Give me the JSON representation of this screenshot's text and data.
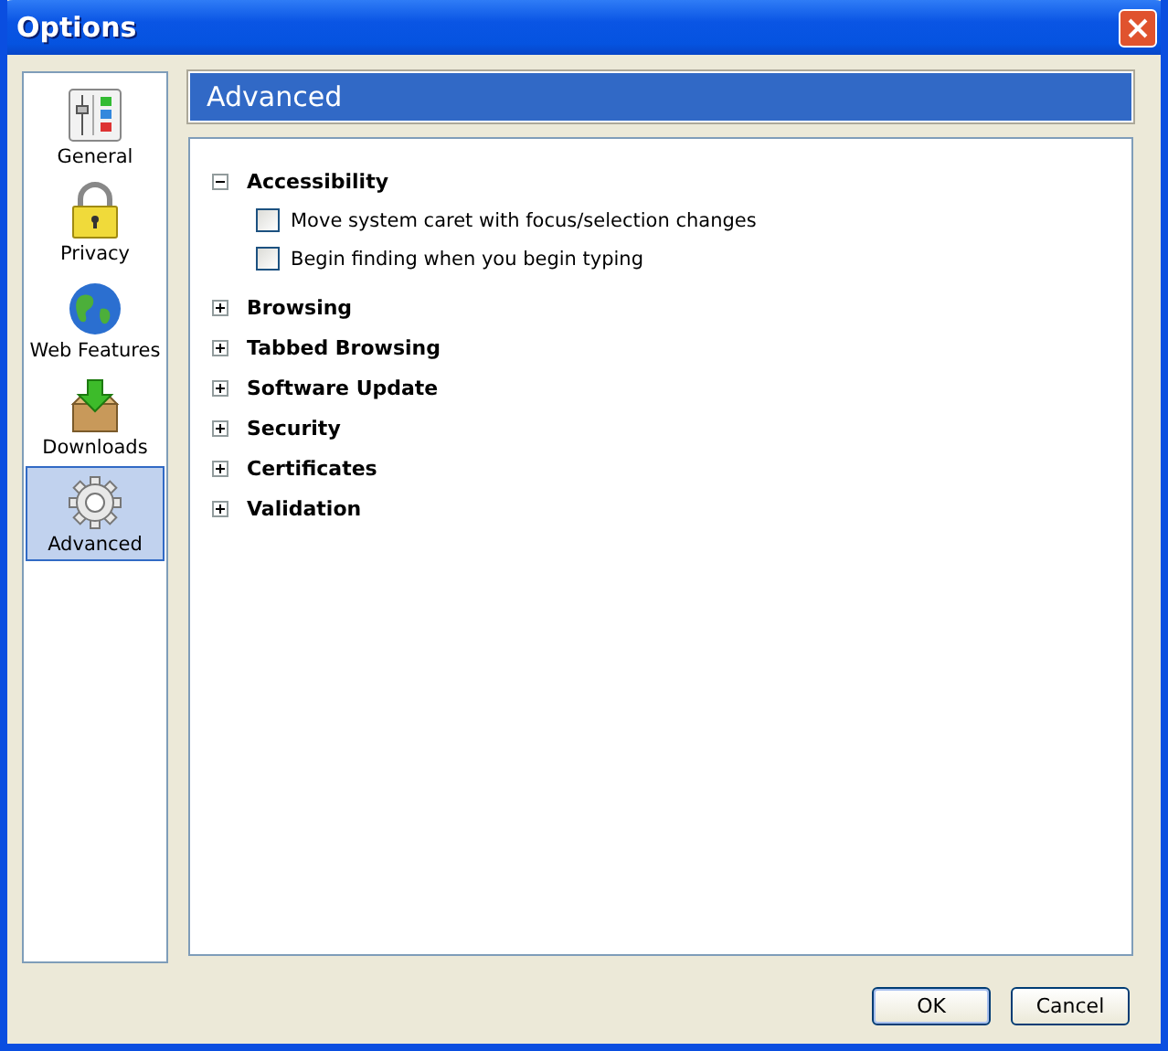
{
  "window": {
    "title": "Options"
  },
  "sidebar": {
    "items": [
      {
        "label": "General",
        "selected": false
      },
      {
        "label": "Privacy",
        "selected": false
      },
      {
        "label": "Web Features",
        "selected": false
      },
      {
        "label": "Downloads",
        "selected": false
      },
      {
        "label": "Advanced",
        "selected": true
      }
    ]
  },
  "header": {
    "title": "Advanced"
  },
  "tree": [
    {
      "label": "Accessibility",
      "expanded": true,
      "children": [
        {
          "label": "Move system caret with focus/selection changes",
          "checked": false
        },
        {
          "label": "Begin finding when you begin typing",
          "checked": false
        }
      ]
    },
    {
      "label": "Browsing",
      "expanded": false
    },
    {
      "label": "Tabbed Browsing",
      "expanded": false
    },
    {
      "label": "Software Update",
      "expanded": false
    },
    {
      "label": "Security",
      "expanded": false
    },
    {
      "label": "Certificates",
      "expanded": false
    },
    {
      "label": "Validation",
      "expanded": false
    }
  ],
  "buttons": [
    "OK",
    "Cancel"
  ]
}
